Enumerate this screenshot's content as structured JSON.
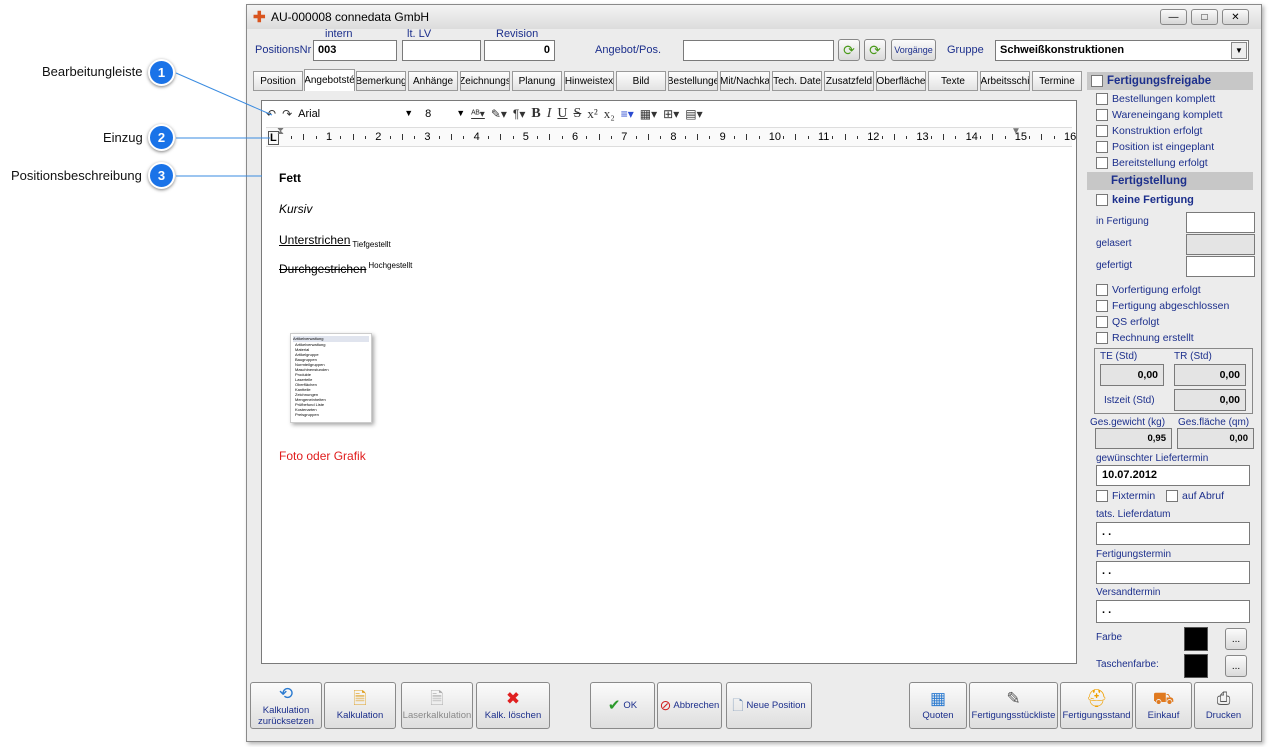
{
  "annotations": [
    {
      "num": "1",
      "label": "Bearbeitungleiste"
    },
    {
      "num": "2",
      "label": "Einzug"
    },
    {
      "num": "3",
      "label": "Positionsbeschreibung"
    }
  ],
  "window": {
    "title": "AU-000008 connedata GmbH",
    "controls": [
      "—",
      "□",
      "✕"
    ]
  },
  "header": {
    "positionsnr_label": "PositionsNr",
    "positionsnr_value": "003",
    "intern_label": "intern",
    "ltlv_label": "lt. LV",
    "revision_label": "Revision",
    "revision_value": "0",
    "angebot_label": "Angebot/Pos.",
    "angebot_value": "",
    "vorgaenge_label": "Vorgänge",
    "gruppe_label": "Gruppe",
    "gruppe_value": "Schweißkonstruktionen"
  },
  "tabs": [
    "Position",
    "Angebotsté",
    "Bemerkung",
    "Anhänge",
    "Zeichnungs",
    "Planung",
    "Hinweistex",
    "Bild",
    "Bestellunge",
    "Mit/Nachka",
    "Tech. Date",
    "Zusatzfeld",
    "Oberfläche",
    "Texte",
    "Arbeitsschi",
    "Termine"
  ],
  "toolbar": {
    "font": "Arial",
    "size": "8",
    "bold": "B",
    "italic": "I",
    "underline": "U",
    "strike": "S"
  },
  "ruler": [
    "1",
    "2",
    "3",
    "4",
    "5",
    "6",
    "7",
    "8",
    "9",
    "10",
    "11",
    "12",
    "13",
    "14",
    "15",
    "16"
  ],
  "editor": {
    "fett": "Fett",
    "kursiv": "Kursiv",
    "unterstrichen": "Unterstrichen",
    "tiefgestellt": "Tiefgestellt",
    "durchgestrichen": "Durchgestrichen",
    "hochgestellt": "Hochgestellt",
    "foto": "Foto oder Grafik"
  },
  "right": {
    "freigabe_title": "Fertigungsfreigabe",
    "freigabe_items": [
      "Bestellungen komplett",
      "Wareneingang komplett",
      "Konstruktion erfolgt",
      "Position ist eingeplant",
      "Bereitstellung erfolgt"
    ],
    "fertigstellung_title": "Fertigstellung",
    "keine_fertigung": "keine Fertigung",
    "in_fertigung": "in Fertigung",
    "gelasert": "gelasert",
    "gefertigt": "gefertigt",
    "status_items": [
      "Vorfertigung erfolgt",
      "Fertigung abgeschlossen",
      "QS erfolgt",
      "Rechnung erstellt"
    ],
    "te_label": "TE (Std)",
    "tr_label": "TR (Std)",
    "te_value": "0,00",
    "tr_value": "0,00",
    "istzeit_label": "Istzeit (Std)",
    "istzeit_value": "0,00",
    "gewicht_label": "Ges.gewicht (kg)",
    "flaeche_label": "Ges.fläche (qm)",
    "gewicht_value": "0,95",
    "flaeche_value": "0,00",
    "liefertermin_label": "gewünschter Liefertermin",
    "liefertermin_value": "10.07.2012",
    "fixtermin": "Fixtermin",
    "auf_abruf": "auf Abruf",
    "tats_label": "tats. Lieferdatum",
    "tats_value": ". .",
    "fertigungstermin_label": "Fertigungstermin",
    "fertigungstermin_value": ". .",
    "versandtermin_label": "Versandtermin",
    "versandtermin_value": ". .",
    "farbe_label": "Farbe",
    "taschenfarbe_label": "Taschenfarbe:",
    "dots": "...",
    "colors": {
      "farbe": "#000000",
      "taschenfarbe": "#000000"
    }
  },
  "buttons": {
    "kalk_reset": "Kalkulation zurücksetzen",
    "kalkulation": "Kalkulation",
    "laser": "Laserkalkulation",
    "kalk_loeschen": "Kalk. löschen",
    "ok": "OK",
    "abbrechen": "Abbrechen",
    "neue_position": "Neue Position",
    "quoten": "Quoten",
    "stueckliste": "Fertigungsstückliste",
    "fertigungsstand": "Fertigungsstand",
    "einkauf": "Einkauf",
    "drucken": "Drucken"
  },
  "thumbnail": {
    "title": "Artikelverwaltung",
    "items": [
      "Artikelverwaltung",
      "Material",
      "Artikelgruppe",
      "Baugruppen",
      "Normteilgruppen",
      "Maschinenstunden",
      "Produkte",
      "Laserteile",
      "Oberflächen",
      "Kantteile",
      "Zeichnungen",
      "Mengeneinheiten",
      "Prüfbefund Liste",
      "Kostenarten",
      "Preisgruppen"
    ]
  }
}
